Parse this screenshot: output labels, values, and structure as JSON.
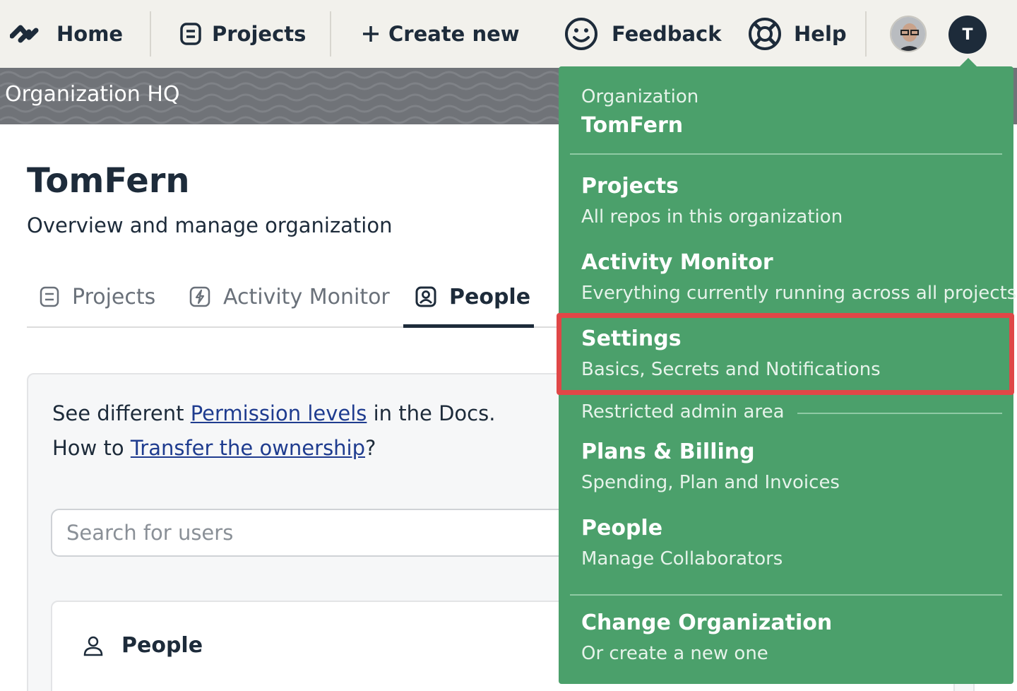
{
  "topnav": {
    "home": "Home",
    "projects": "Projects",
    "create_new": "Create new",
    "feedback": "Feedback",
    "help": "Help",
    "user_initial": "T"
  },
  "banner": {
    "title": "Organization HQ"
  },
  "main": {
    "title": "TomFern",
    "subtitle": "Overview and manage organization",
    "tabs": [
      {
        "label": "Projects",
        "icon": "project-icon"
      },
      {
        "label": "Activity Monitor",
        "icon": "bolt-icon"
      },
      {
        "label": "People",
        "icon": "person-badge-icon",
        "active": true
      }
    ],
    "docs": {
      "line1_prefix": "See different ",
      "line1_link": "Permission levels",
      "line1_suffix": " in the Docs.",
      "line2_prefix": "How to ",
      "line2_link": "Transfer the ownership",
      "line2_suffix": "?"
    },
    "search_placeholder": "Search for users",
    "people_section": "People"
  },
  "dropdown": {
    "org_label": "Organization",
    "org_name": "TomFern",
    "items": [
      {
        "title": "Projects",
        "desc": "All repos in this organization"
      },
      {
        "title": "Activity Monitor",
        "desc": "Everything currently running across all projects"
      },
      {
        "title": "Settings",
        "desc": "Basics, Secrets and Notifications"
      }
    ],
    "restricted_label": "Restricted admin area",
    "admin_items": [
      {
        "title": "Plans & Billing",
        "desc": "Spending, Plan and Invoices"
      },
      {
        "title": "People",
        "desc": "Manage Collaborators"
      }
    ],
    "change_org": {
      "title": "Change Organization",
      "desc": "Or create a new one"
    }
  },
  "colors": {
    "dropdown_bg": "#4ba06b",
    "highlight": "#e04747",
    "nav_bg": "#f2f1ec",
    "text_dark": "#1d2b3a",
    "link": "#1f3c8f"
  }
}
